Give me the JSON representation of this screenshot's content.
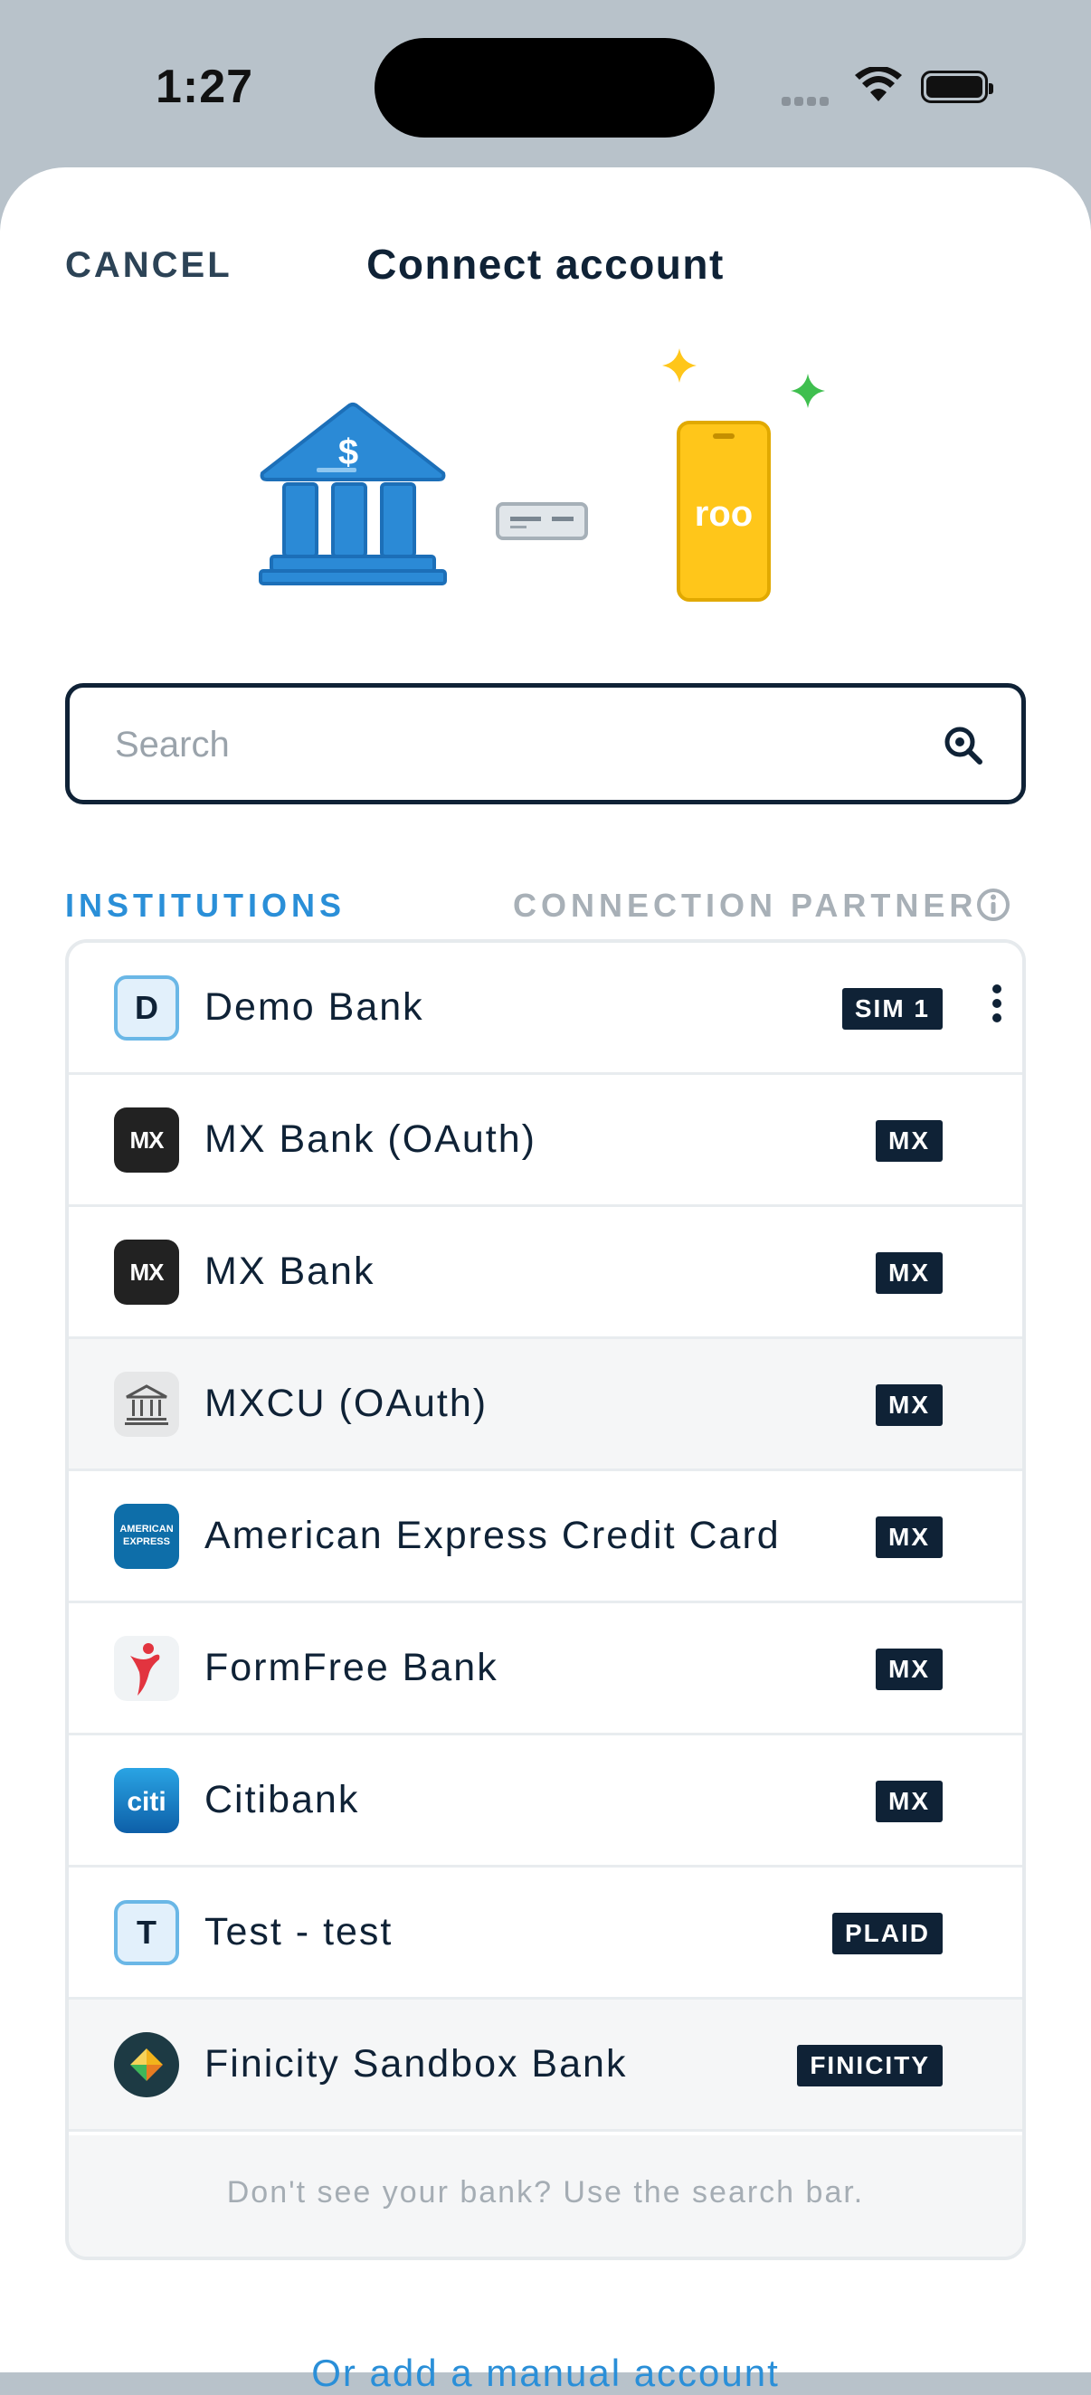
{
  "status_bar": {
    "time": "1:27"
  },
  "header": {
    "cancel_label": "CANCEL",
    "title": "Connect account"
  },
  "hero": {
    "phone_brand": "roo",
    "bank_symbol": "$"
  },
  "search": {
    "placeholder": "Search",
    "value": ""
  },
  "columns": {
    "left": "INSTITUTIONS",
    "right": "CONNECTION PARTNER"
  },
  "institutions": [
    {
      "name": "Demo Bank",
      "partner": "SIM 1",
      "logo": "letter",
      "logo_text": "D"
    },
    {
      "name": "MX Bank (OAuth)",
      "partner": "MX",
      "logo": "mx",
      "logo_text": "MX"
    },
    {
      "name": "MX Bank",
      "partner": "MX",
      "logo": "mx",
      "logo_text": "MX"
    },
    {
      "name": "MXCU (OAuth)",
      "partner": "MX",
      "logo": "bank-icon"
    },
    {
      "name": "American Express Credit Card",
      "partner": "MX",
      "logo": "amex",
      "logo_text": "AMERICAN EXPRESS"
    },
    {
      "name": "FormFree Bank",
      "partner": "MX",
      "logo": "formfree"
    },
    {
      "name": "Citibank",
      "partner": "MX",
      "logo": "citi",
      "logo_text": "citi"
    },
    {
      "name": "Test - test",
      "partner": "PLAID",
      "logo": "letter",
      "logo_text": "T"
    },
    {
      "name": "Finicity Sandbox Bank",
      "partner": "FINICITY",
      "logo": "finicity"
    }
  ],
  "list_footer": "Don't see your bank? Use the search bar.",
  "manual_link": "Or add a manual account",
  "colors": {
    "navy": "#0f2236",
    "accent_blue": "#2a8fd8",
    "bank_blue": "#2b8ad6",
    "phone_yellow": "#ffc61a",
    "spark_green": "#3fbf4f"
  }
}
